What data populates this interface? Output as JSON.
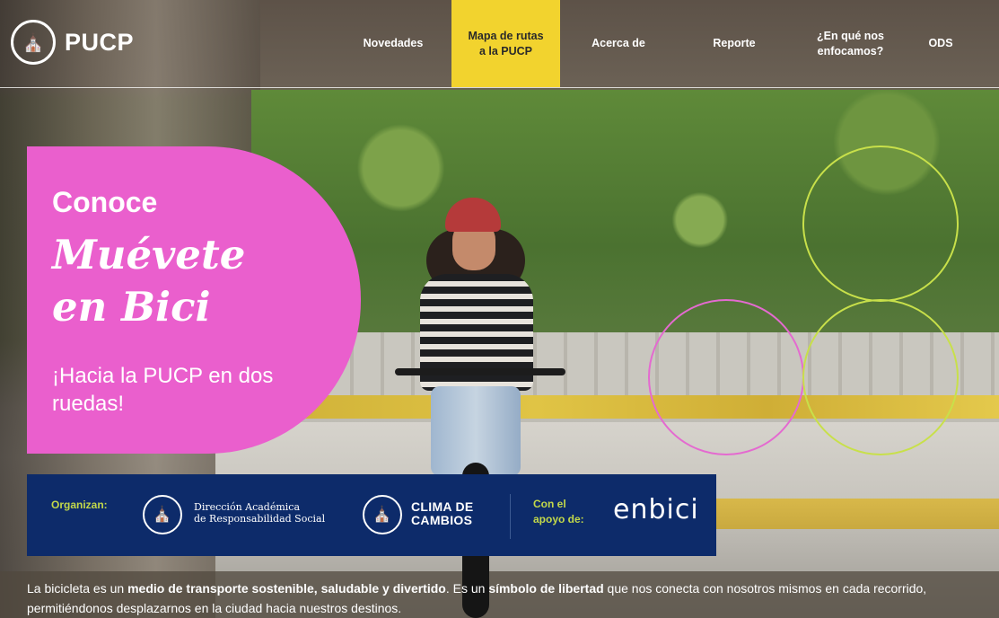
{
  "header": {
    "brand": "PUCP",
    "logo_icon": "pucp-seal-icon",
    "nav": [
      {
        "label": "Novedades"
      },
      {
        "label": "Mapa de rutas a la PUCP",
        "line1": "Mapa de rutas",
        "line2": "a la PUCP",
        "active": true
      },
      {
        "label": "Acerca de"
      },
      {
        "label": "Reporte"
      },
      {
        "label": "¿En qué nos enfocamos?",
        "line1": "¿En qué nos",
        "line2": "enfocamos?"
      },
      {
        "label": "ODS"
      }
    ]
  },
  "hero": {
    "kicker": "Conoce",
    "title_line1": "Muévete",
    "title_line2": "en Bici",
    "subtitle": "¡Hacia la PUCP en dos ruedas!"
  },
  "sponsors": {
    "organizan_label": "Organizan:",
    "dars_line1": "Dirección Académica",
    "dars_line2": "de Responsabilidad Social",
    "clima_line1": "CLIMA DE",
    "clima_line2": "CAMBIOS",
    "apoyo_line1": "Con el",
    "apoyo_line2": "apoyo de:",
    "enbici": "enbici"
  },
  "footer": {
    "t1": "La bicicleta es un ",
    "b1": "medio de transporte sostenible, saludable y divertido",
    "t2": ". Es un ",
    "b2": "símbolo de libertad",
    "t3": " que nos conecta con nosotros mismos en cada recorrido, permitiéndonos desplazarnos en la ciudad hacia nuestros destinos."
  },
  "colors": {
    "accent_yellow": "#f2d32e",
    "hero_pink": "#ea5fcd",
    "sponsor_navy": "#0d2b6a",
    "label_green": "#c2d84a",
    "ring_green": "#c8e04a",
    "ring_pink": "#e46ad0"
  }
}
